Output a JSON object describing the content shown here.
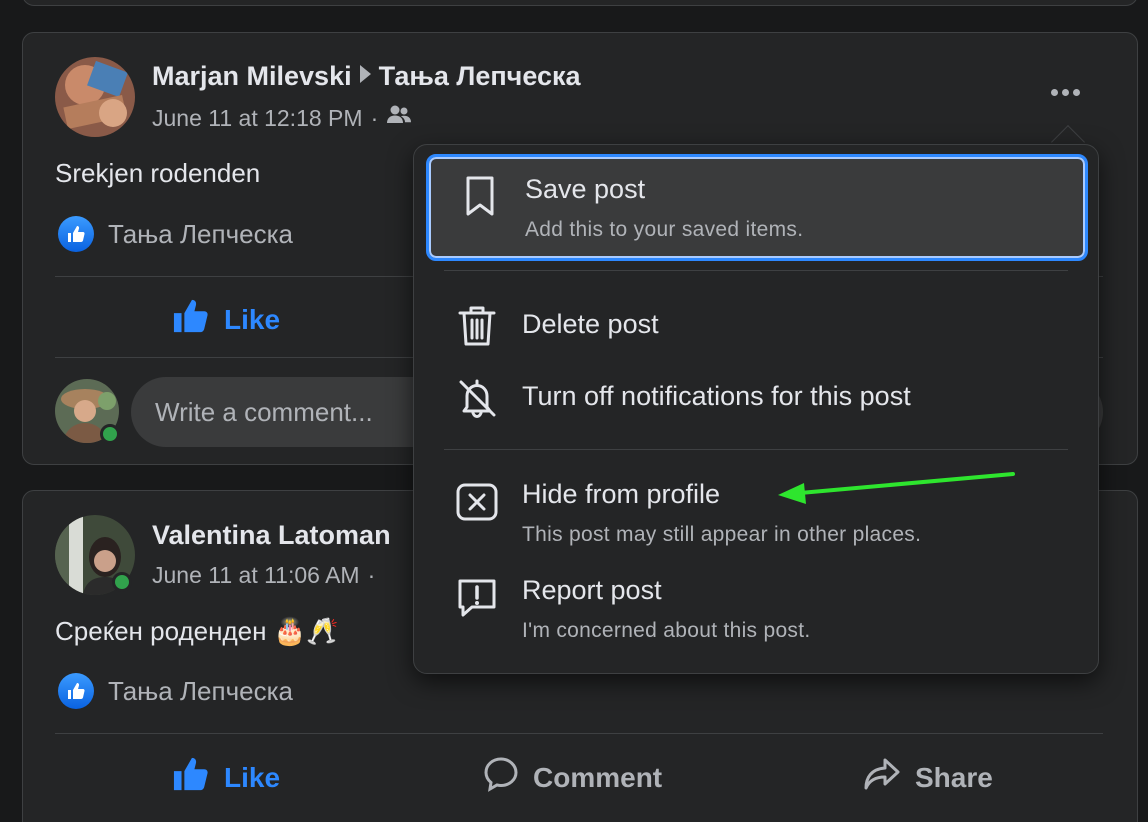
{
  "post1": {
    "author": "Marjan Milevski",
    "recipient": "Тања Лепческа",
    "timestamp": "June 11 at 12:18 PM",
    "separator": "·",
    "audience_icon": "friends-icon",
    "text": "Srekjen rodenden",
    "reaction_name": "Тања Лепческа",
    "like_label": "Like",
    "comment_placeholder": "Write a comment..."
  },
  "post2": {
    "author": "Valentina Latoman",
    "timestamp": "June 11 at 11:06 AM",
    "separator": "·",
    "text": "Среќен роденден 🎂🥂",
    "reaction_name": "Тања Лепческа",
    "like_label": "Like",
    "comment_label": "Comment",
    "share_label": "Share"
  },
  "menu": {
    "items": [
      {
        "icon": "bookmark-icon",
        "title": "Save post",
        "description": "Add this to your saved items."
      },
      {
        "icon": "trash-icon",
        "title": "Delete post",
        "description": ""
      },
      {
        "icon": "bell-off-icon",
        "title": "Turn off notifications for this post",
        "description": ""
      },
      {
        "icon": "hide-x-icon",
        "title": "Hide from profile",
        "description": "This post may still appear in other places."
      },
      {
        "icon": "report-icon",
        "title": "Report post",
        "description": "I'm concerned about this post."
      }
    ]
  },
  "colors": {
    "background": "#18191a",
    "card": "#242526",
    "accent": "#2d88ff",
    "annotation_arrow": "#2ee52e",
    "online": "#31a24c"
  }
}
